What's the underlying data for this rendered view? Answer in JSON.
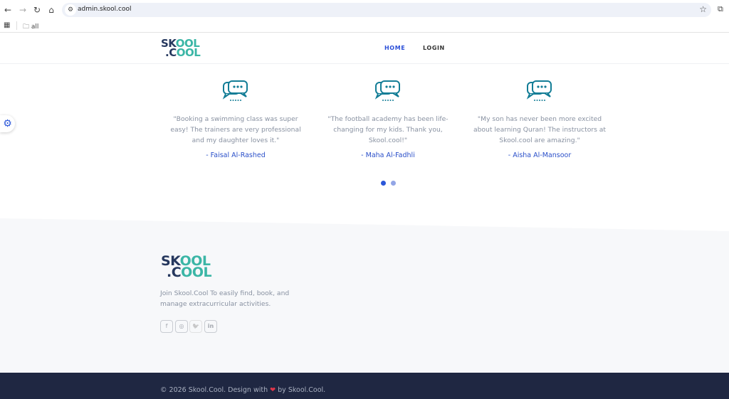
{
  "browser": {
    "url": "admin.skool.cool",
    "bookmark_folder": "all",
    "icons": [
      "back-icon",
      "forward-icon",
      "reload-icon",
      "home-icon",
      "site-settings-icon",
      "star-icon",
      "extensions-icon",
      "apps-icon",
      "folder-icon"
    ]
  },
  "nav": {
    "logo_top": "SK",
    "logo_top2": "OOL",
    "logo_bottom": ".C",
    "logo_bottom2": "OOL",
    "home": "HOME",
    "login": "LOGIN",
    "active_color": "#2b4fd8"
  },
  "testimonials": [
    {
      "quote": "\"Booking a swimming class was super easy! The trainers are very professional and my daughter loves it.\"",
      "author": "- Faisal Al-Rashed"
    },
    {
      "quote": "\"The football academy has been life-changing for my kids. Thank you, Skool.cool!\"",
      "author": "- Maha Al-Fadhli"
    },
    {
      "quote": "\"My son has never been more excited about learning Quran! The instructors at Skool.cool are amazing.\"",
      "author": "- Aisha Al-Mansoor"
    }
  ],
  "carousel": {
    "pages": 2,
    "active": 1
  },
  "footer": {
    "tagline": "Join Skool.Cool To easily find, book, and manage extracurricular activities.",
    "social": [
      "facebook",
      "instagram",
      "twitter",
      "linkedin"
    ],
    "social_glyphs": [
      "f",
      "◎",
      "🐦",
      "in"
    ]
  },
  "bottom": {
    "copy_before": "© 2026 Skool.Cool. Design with",
    "heart": "❤",
    "copy_after": "by Skool.Cool."
  }
}
